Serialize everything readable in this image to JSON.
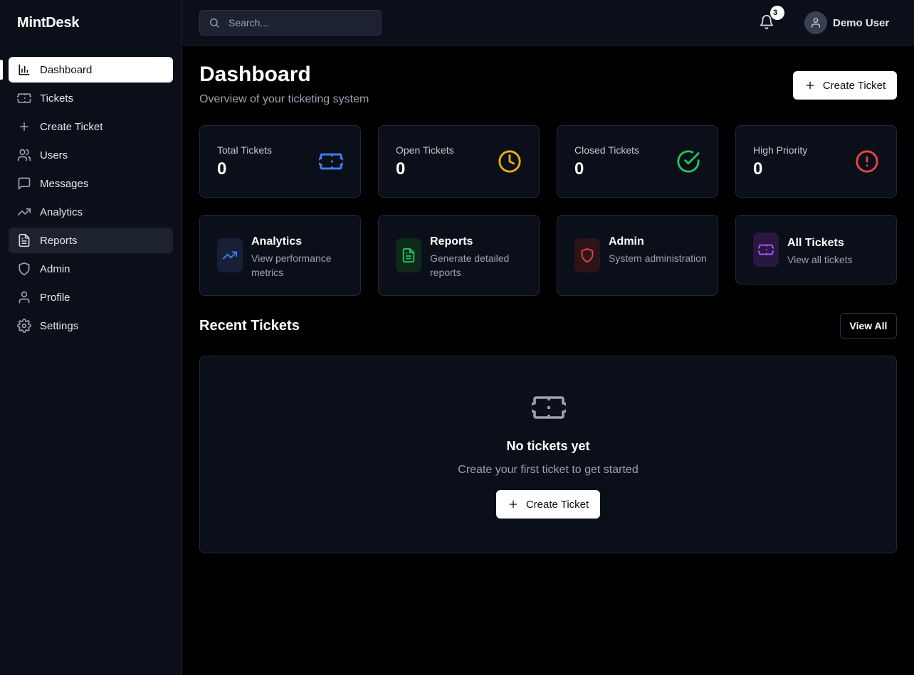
{
  "app": {
    "brand": "MintDesk"
  },
  "sidebar": {
    "items": [
      {
        "label": "Dashboard",
        "icon": "bar-chart-icon",
        "state": "active"
      },
      {
        "label": "Tickets",
        "icon": "ticket-icon"
      },
      {
        "label": "Create Ticket",
        "icon": "plus-icon"
      },
      {
        "label": "Users",
        "icon": "users-icon"
      },
      {
        "label": "Messages",
        "icon": "message-square-icon"
      },
      {
        "label": "Analytics",
        "icon": "trending-up-icon"
      },
      {
        "label": "Reports",
        "icon": "file-text-icon",
        "state": "hover"
      },
      {
        "label": "Admin",
        "icon": "shield-icon"
      },
      {
        "label": "Profile",
        "icon": "user-icon"
      },
      {
        "label": "Settings",
        "icon": "gear-icon"
      }
    ]
  },
  "header": {
    "search_placeholder": "Search...",
    "notification_count": "3",
    "user_name": "Demo User"
  },
  "main": {
    "title": "Dashboard",
    "subtitle": "Overview of your ticketing system",
    "create_button": "Create Ticket",
    "stats": [
      {
        "label": "Total Tickets",
        "value": "0",
        "icon": "ticket-icon",
        "color": "#3b82f6"
      },
      {
        "label": "Open Tickets",
        "value": "0",
        "icon": "clock-icon",
        "color": "#eab308"
      },
      {
        "label": "Closed Tickets",
        "value": "0",
        "icon": "check-circle-icon",
        "color": "#22c55e"
      },
      {
        "label": "High Priority",
        "value": "0",
        "icon": "alert-circle-icon",
        "color": "#ef4444"
      }
    ],
    "quick_links": [
      {
        "title": "Analytics",
        "description": "View performance metrics",
        "icon": "trending-up-icon",
        "color": "#3b82f6"
      },
      {
        "title": "Reports",
        "description": "Generate detailed reports",
        "icon": "file-text-icon",
        "color": "#22c55e"
      },
      {
        "title": "Admin",
        "description": "System administration",
        "icon": "shield-icon",
        "color": "#ef4444"
      },
      {
        "title": "All Tickets",
        "description": "View all tickets",
        "icon": "ticket-icon",
        "color": "#a855f7"
      }
    ],
    "recent": {
      "title": "Recent Tickets",
      "view_all": "View All",
      "empty_title": "No tickets yet",
      "empty_subtitle": "Create your first ticket to get started",
      "empty_button": "Create Ticket"
    }
  }
}
